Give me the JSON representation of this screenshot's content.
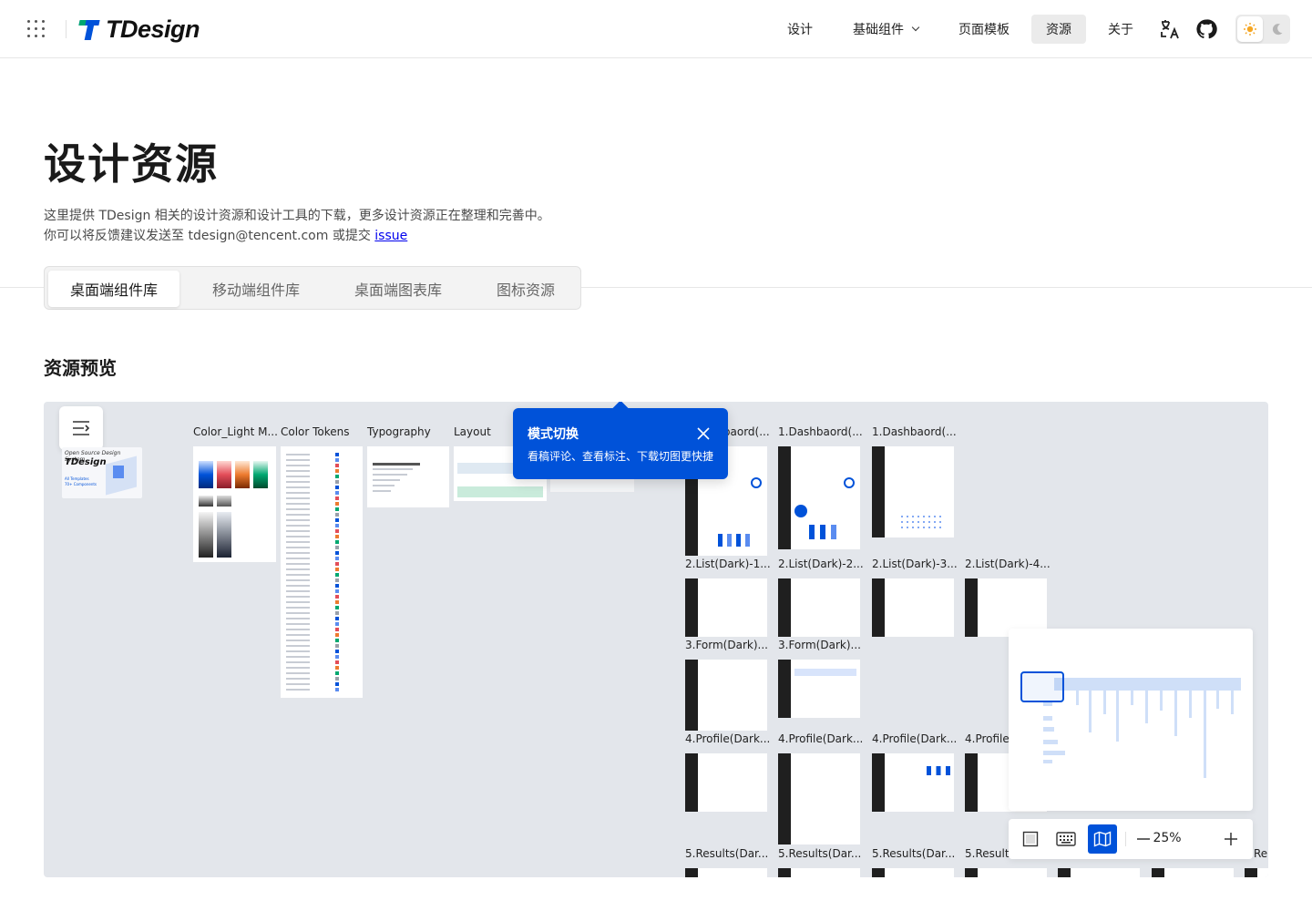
{
  "header": {
    "logo_text": "TDesign",
    "nav": [
      {
        "label": "设计"
      },
      {
        "label": "基础组件"
      },
      {
        "label": "页面模板"
      },
      {
        "label": "资源",
        "active": true
      },
      {
        "label": "关于"
      }
    ],
    "icons": [
      "apps-grid-icon",
      "translate-icon",
      "github-icon",
      "sun-icon",
      "moon-icon"
    ]
  },
  "page": {
    "title": "设计资源",
    "desc_line1": "这里提供 TDesign 相关的设计资源和设计工具的下载，更多设计资源正在整理和完善中。",
    "desc_line2_prefix": "你可以将反馈建议发送至 tdesign@tencent.com 或提交 ",
    "desc_link": "issue",
    "tabs": [
      {
        "label": "桌面端组件库",
        "active": true
      },
      {
        "label": "移动端组件库"
      },
      {
        "label": "桌面端图表库"
      },
      {
        "label": "图标资源"
      }
    ],
    "section_title": "资源预览"
  },
  "preview": {
    "cover_text_1": "Open Source Design System",
    "cover_text_2": "TDesign",
    "cover_text_3": "All Templates",
    "cover_text_4": "70+ Components",
    "frames_row1": [
      "Color_Light M...",
      "Color Tokens",
      "Typography",
      "Layout",
      "1.Dashbaord(...",
      "1.Dashbaord(...",
      "1.Dashbaord(..."
    ],
    "frames_row2": [
      "2.List(Dark)-1...",
      "2.List(Dark)-2...",
      "2.List(Dark)-3...",
      "2.List(Dark)-4..."
    ],
    "frames_row3": [
      "3.Form(Dark)...",
      "3.Form(Dark)..."
    ],
    "frames_row4": [
      "4.Profile(Dark...",
      "4.Profile(Dark...",
      "4.Profile(Dark...",
      "4.Profile"
    ],
    "frames_row5": [
      "5.Results(Dar...",
      "5.Results(Dar...",
      "5.Results(Dar...",
      "5.Result",
      "Re"
    ],
    "tooltip": {
      "title": "模式切换",
      "body": "看稿评论、查看标注、下载切图更快捷"
    },
    "toolbar": {
      "zoom": "25%",
      "modes": [
        "frame-view-icon",
        "keyboard-icon",
        "minimap-icon"
      ],
      "active_mode": "minimap-icon"
    }
  },
  "colors": {
    "brand": "#0052d9",
    "canvas_bg": "#e3e6eb",
    "tab_bg": "#f3f3f3"
  }
}
